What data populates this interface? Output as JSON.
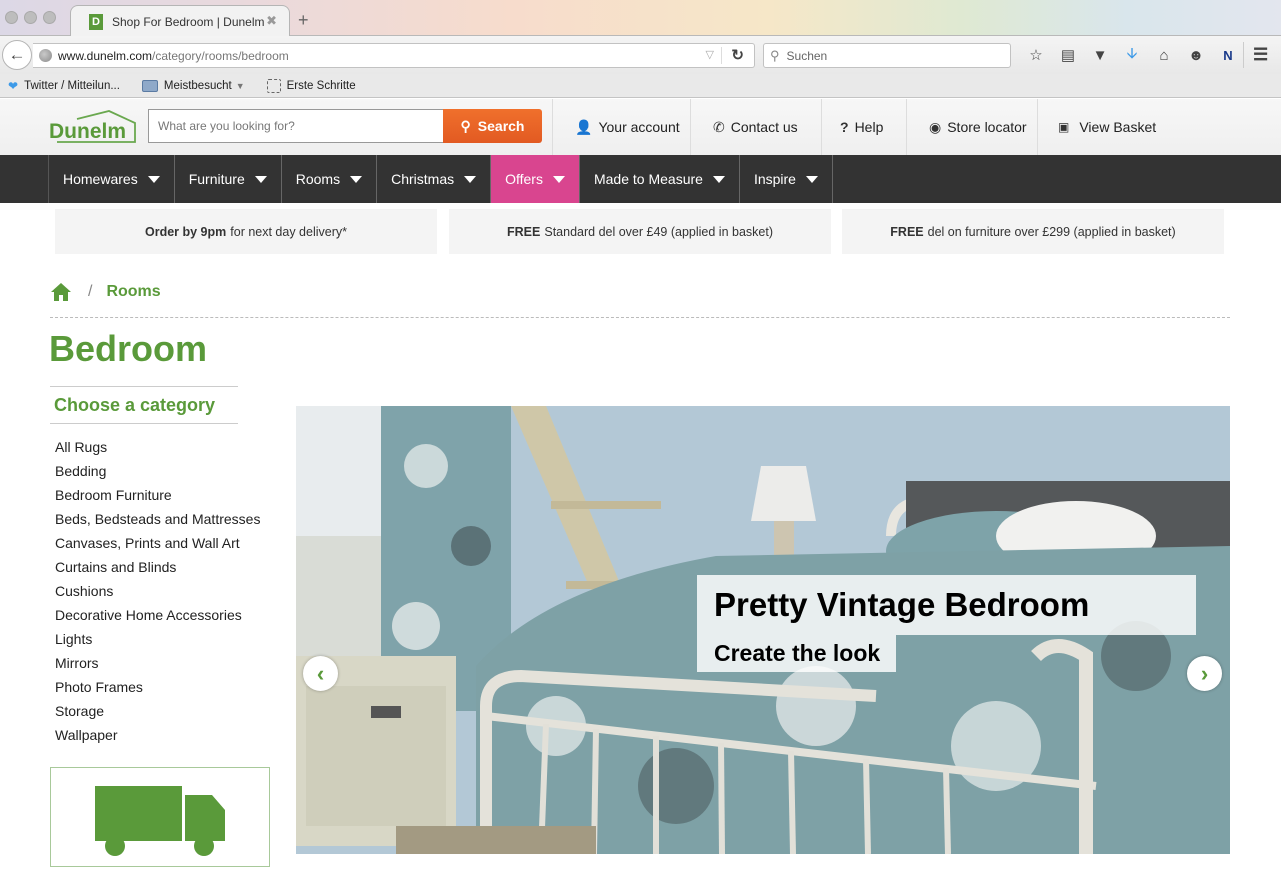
{
  "browser": {
    "tab_title": "Shop For Bedroom | Dunelm",
    "tab_favicon_letter": "D",
    "tab_close_glyph": "✖",
    "new_tab_glyph": "+",
    "url_domain": "www.dunelm.com",
    "url_path": "/category/rooms/bedroom",
    "search_placeholder": "Suchen",
    "toolbar_icons": [
      "star-icon",
      "reading-list-icon",
      "pocket-icon",
      "download-icon",
      "home-icon",
      "chat-icon",
      "note-add-icon",
      "menu-icon"
    ],
    "bookmarks": [
      {
        "label": "Twitter / Mitteilun...",
        "icon": "twitter-icon"
      },
      {
        "label": "Meistbesucht",
        "icon": "folder-icon",
        "dropdown": true
      },
      {
        "label": "Erste Schritte",
        "icon": "dashed-page-icon"
      }
    ]
  },
  "header": {
    "logo_text": "Dunelm",
    "search_placeholder": "What are you looking for?",
    "search_button": "Search",
    "links": [
      {
        "label": "Your account",
        "icon": "user-icon"
      },
      {
        "label": "Contact us",
        "icon": "phone-icon"
      },
      {
        "label": "Help",
        "icon": "help-icon"
      },
      {
        "label": "Store locator",
        "icon": "map-pin-icon"
      },
      {
        "label": "View Basket",
        "icon": "basket-icon"
      }
    ]
  },
  "nav": {
    "items": [
      {
        "label": "Homewares",
        "active": false
      },
      {
        "label": "Furniture",
        "active": false
      },
      {
        "label": "Rooms",
        "active": false
      },
      {
        "label": "Christmas",
        "active": false
      },
      {
        "label": "Offers",
        "active": true
      },
      {
        "label": "Made to Measure",
        "active": false
      },
      {
        "label": "Inspire",
        "active": false
      }
    ],
    "offers_color": "#d9458f"
  },
  "delivery": [
    {
      "bold": "Order by 9pm",
      "text": "for next day delivery*"
    },
    {
      "bold": "FREE",
      "text": "Standard del over £49 (applied in basket)"
    },
    {
      "bold": "FREE",
      "text": "del on furniture over £299 (applied in basket)"
    }
  ],
  "breadcrumb": {
    "separator": "/",
    "current": "Rooms"
  },
  "page": {
    "title": "Bedroom",
    "brand_color": "#5a9a3a"
  },
  "sidebar": {
    "heading": "Choose a category",
    "categories": [
      "All Rugs",
      "Bedding",
      "Bedroom Furniture",
      "Beds, Bedsteads and Mattresses",
      "Canvases, Prints and Wall Art",
      "Curtains and Blinds",
      "Cushions",
      "Decorative Home Accessories",
      "Lights",
      "Mirrors",
      "Photo Frames",
      "Storage",
      "Wallpaper"
    ]
  },
  "hero": {
    "title": "Pretty Vintage Bedroom",
    "subtitle": "Create the look",
    "prev_glyph": "‹",
    "next_glyph": "›"
  }
}
